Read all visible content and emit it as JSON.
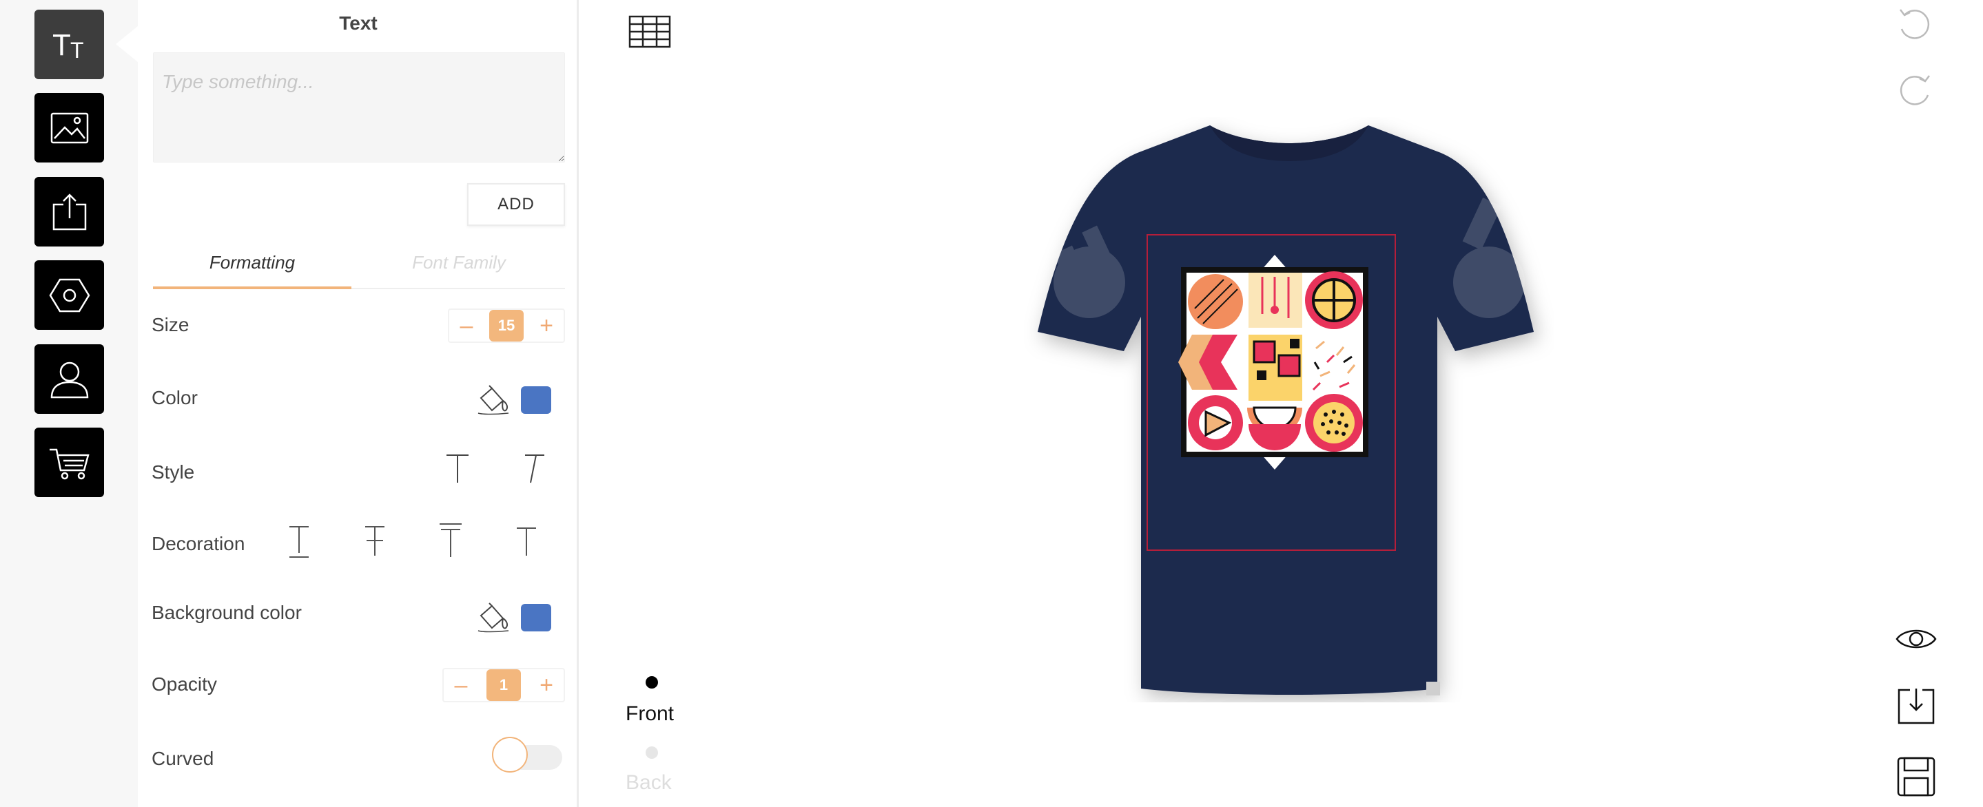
{
  "toolbar": {
    "tools": [
      {
        "icon": "text-icon",
        "label": "Tт"
      },
      {
        "icon": "image-icon"
      },
      {
        "icon": "upload-icon"
      },
      {
        "icon": "hexagon-icon"
      },
      {
        "icon": "user-icon"
      },
      {
        "icon": "cart-icon"
      }
    ]
  },
  "panel": {
    "title": "Text",
    "text_input": {
      "placeholder": "Type something...",
      "value": ""
    },
    "add_label": "ADD",
    "tabs": [
      {
        "label": "Formatting",
        "active": true
      },
      {
        "label": "Font Family",
        "active": false
      }
    ],
    "size": {
      "label": "Size",
      "value": "15",
      "minus": "–",
      "plus": "+"
    },
    "color": {
      "label": "Color",
      "swatch": "#4a75c3"
    },
    "style": {
      "label": "Style"
    },
    "decoration": {
      "label": "Decoration"
    },
    "background_color": {
      "label": "Background color",
      "swatch": "#4a75c3"
    },
    "opacity": {
      "label": "Opacity",
      "value": "1",
      "minus": "–",
      "plus": "+"
    },
    "curved": {
      "label": "Curved",
      "on": false
    }
  },
  "canvas": {
    "views": [
      {
        "label": "Front",
        "active": true
      },
      {
        "label": "Back",
        "active": false
      }
    ],
    "shirt_color": "#1f2a4e",
    "accent_color": "#f3b77d"
  }
}
